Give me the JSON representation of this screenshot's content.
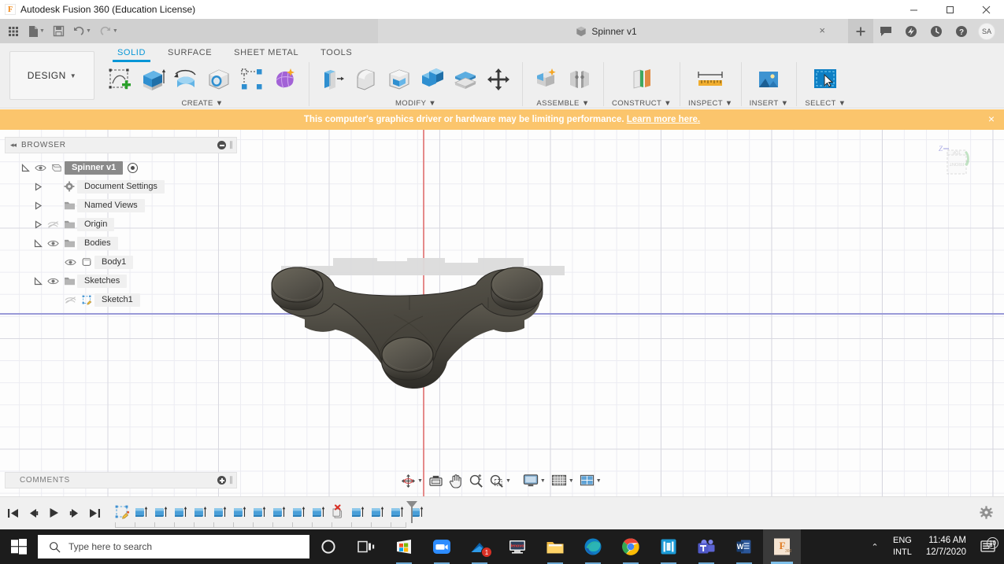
{
  "window": {
    "title": "Autodesk Fusion 360 (Education License)",
    "app_icon": "F",
    "minimize": "–",
    "maximize": "❑",
    "close": "×"
  },
  "quick_access": {
    "items": [
      {
        "name": "app-grid-icon",
        "label": "grid"
      },
      {
        "name": "new-file-icon",
        "label": "file"
      },
      {
        "name": "save-icon",
        "label": "save"
      },
      {
        "name": "undo-icon",
        "label": "undo"
      },
      {
        "name": "redo-icon",
        "label": "redo"
      }
    ]
  },
  "document_tab": {
    "name": "Spinner v1",
    "close_label": "×",
    "add_tab_label": "+"
  },
  "header_icons": [
    {
      "name": "comments-icon",
      "label": "Comments"
    },
    {
      "name": "job-status-icon",
      "label": "Job Status"
    },
    {
      "name": "recent-icon",
      "label": "Recent"
    },
    {
      "name": "help-icon",
      "label": "Help"
    }
  ],
  "account": {
    "initials": "SA"
  },
  "ribbon": {
    "workspace": "DESIGN",
    "workspace_caret": "▾",
    "tabs": [
      {
        "label": "SOLID",
        "active": true
      },
      {
        "label": "SURFACE",
        "active": false
      },
      {
        "label": "SHEET METAL",
        "active": false
      },
      {
        "label": "TOOLS",
        "active": false
      }
    ],
    "panels": [
      {
        "label": "CREATE",
        "caret": "▾",
        "tools": [
          {
            "name": "create-sketch-icon"
          },
          {
            "name": "extrude-icon"
          },
          {
            "name": "revolve-icon"
          },
          {
            "name": "hole-icon"
          },
          {
            "name": "pattern-icon"
          },
          {
            "name": "form-icon"
          }
        ]
      },
      {
        "label": "MODIFY",
        "caret": "▾",
        "tools": [
          {
            "name": "press-pull-icon"
          },
          {
            "name": "fillet-icon"
          },
          {
            "name": "shell-icon"
          },
          {
            "name": "combine-icon"
          },
          {
            "name": "split-face-icon"
          },
          {
            "name": "move-copy-icon"
          }
        ]
      },
      {
        "label": "ASSEMBLE",
        "caret": "▾",
        "tools": [
          {
            "name": "new-component-icon"
          },
          {
            "name": "joint-icon"
          }
        ]
      },
      {
        "label": "CONSTRUCT",
        "caret": "▾",
        "tools": [
          {
            "name": "offset-plane-icon"
          }
        ]
      },
      {
        "label": "INSPECT",
        "caret": "▾",
        "tools": [
          {
            "name": "measure-icon"
          }
        ]
      },
      {
        "label": "INSERT",
        "caret": "▾",
        "tools": [
          {
            "name": "insert-image-icon"
          }
        ]
      },
      {
        "label": "SELECT",
        "caret": "▾",
        "tools": [
          {
            "name": "select-window-icon"
          }
        ]
      }
    ]
  },
  "banner": {
    "message": "This computer's graphics driver or hardware may be limiting performance.",
    "link": "Learn more here.",
    "close": "×",
    "background": "#fbc56c",
    "text_color": "#ffffff"
  },
  "browser": {
    "title": "BROWSER",
    "collapse_icon": "◂◂",
    "tree": [
      {
        "label": "Spinner v1",
        "indent": 0,
        "expander": "expanded",
        "eye": "visible",
        "icon": "component-icon",
        "selected": true,
        "activate": true
      },
      {
        "label": "Document Settings",
        "indent": 1,
        "expander": "collapsed",
        "eye": "none",
        "icon": "gear-icon",
        "selected": false,
        "activate": false
      },
      {
        "label": "Named Views",
        "indent": 1,
        "expander": "collapsed",
        "eye": "none",
        "icon": "folder-icon",
        "selected": false,
        "activate": false
      },
      {
        "label": "Origin",
        "indent": 1,
        "expander": "collapsed",
        "eye": "hidden",
        "icon": "folder-icon",
        "selected": false,
        "activate": false
      },
      {
        "label": "Bodies",
        "indent": 1,
        "expander": "expanded",
        "eye": "visible",
        "icon": "folder-icon",
        "selected": false,
        "activate": false
      },
      {
        "label": "Body1",
        "indent": 2,
        "expander": "none",
        "eye": "visible",
        "icon": "body-icon",
        "selected": false,
        "activate": false
      },
      {
        "label": "Sketches",
        "indent": 1,
        "expander": "expanded",
        "eye": "visible",
        "icon": "folder-icon",
        "selected": false,
        "activate": false
      },
      {
        "label": "Sketch1",
        "indent": 2,
        "expander": "none",
        "eye": "hidden",
        "icon": "sketch-icon",
        "selected": false,
        "activate": false
      }
    ]
  },
  "comments": {
    "title": "COMMENTS"
  },
  "viewcube": {
    "z_label": "Z",
    "front_label": "FRONT",
    "top_label": "TOP"
  },
  "navbar": {
    "items": [
      {
        "name": "orbit-icon",
        "caret": "▾"
      },
      {
        "name": "look-at-icon",
        "caret": ""
      },
      {
        "name": "pan-icon",
        "caret": ""
      },
      {
        "name": "zoom-icon",
        "caret": ""
      },
      {
        "name": "zoom-window-icon",
        "caret": "▾"
      },
      {
        "name": "display-settings-icon",
        "caret": "▾"
      },
      {
        "name": "grid-snaps-icon",
        "caret": "▾"
      },
      {
        "name": "viewports-icon",
        "caret": "▾"
      }
    ]
  },
  "timeline": {
    "transport": [
      {
        "name": "go-to-beginning-icon"
      },
      {
        "name": "step-back-icon"
      },
      {
        "name": "play-icon"
      },
      {
        "name": "step-forward-icon"
      },
      {
        "name": "go-to-end-icon"
      }
    ],
    "features": [
      {
        "name": "sketch-feature-icon",
        "type": "sketch"
      },
      {
        "name": "extrude-feature-icon",
        "type": "extrude"
      },
      {
        "name": "extrude-feature-icon",
        "type": "extrude"
      },
      {
        "name": "extrude-feature-icon",
        "type": "extrude"
      },
      {
        "name": "extrude-feature-icon",
        "type": "extrude"
      },
      {
        "name": "extrude-feature-icon",
        "type": "extrude"
      },
      {
        "name": "extrude-feature-icon",
        "type": "extrude"
      },
      {
        "name": "extrude-feature-icon",
        "type": "extrude"
      },
      {
        "name": "extrude-feature-icon",
        "type": "extrude"
      },
      {
        "name": "extrude-feature-icon",
        "type": "extrude"
      },
      {
        "name": "extrude-feature-icon",
        "type": "extrude"
      },
      {
        "name": "error-feature-icon",
        "type": "error"
      },
      {
        "name": "extrude-feature-icon",
        "type": "extrude"
      },
      {
        "name": "extrude-feature-icon",
        "type": "extrude"
      },
      {
        "name": "extrude-feature-icon",
        "type": "extrude"
      },
      {
        "name": "extrude-feature-icon",
        "type": "extrude"
      }
    ],
    "settings_icon": "gear-icon"
  },
  "taskbar": {
    "start": "windows-logo-icon",
    "search_placeholder": "Type here to search",
    "icons": [
      {
        "name": "cortana-icon",
        "active": false,
        "open": false,
        "badge": ""
      },
      {
        "name": "task-view-icon",
        "active": false,
        "open": false,
        "badge": ""
      },
      {
        "name": "microsoft-store-icon",
        "active": false,
        "open": true,
        "badge": ""
      },
      {
        "name": "zoom-app-icon",
        "active": false,
        "open": true,
        "badge": ""
      },
      {
        "name": "mail-icon",
        "active": false,
        "open": true,
        "badge": "1"
      },
      {
        "name": "lenovo-vantage-icon",
        "active": false,
        "open": false,
        "badge": ""
      },
      {
        "name": "file-explorer-icon",
        "active": false,
        "open": true,
        "badge": ""
      },
      {
        "name": "microsoft-edge-icon",
        "active": false,
        "open": true,
        "badge": ""
      },
      {
        "name": "google-chrome-icon",
        "active": false,
        "open": true,
        "badge": ""
      },
      {
        "name": "sticky-notes-icon",
        "active": false,
        "open": true,
        "badge": ""
      },
      {
        "name": "microsoft-teams-icon",
        "active": false,
        "open": true,
        "badge": ""
      },
      {
        "name": "microsoft-word-icon",
        "active": false,
        "open": true,
        "badge": ""
      },
      {
        "name": "fusion-360-icon",
        "active": true,
        "open": false,
        "badge": ""
      }
    ],
    "tray_chevron": "⌃",
    "language": {
      "line1": "ENG",
      "line2": "INTL"
    },
    "clock": {
      "time": "11:46 AM",
      "date": "12/7/2020"
    },
    "action_center_count": "10"
  }
}
